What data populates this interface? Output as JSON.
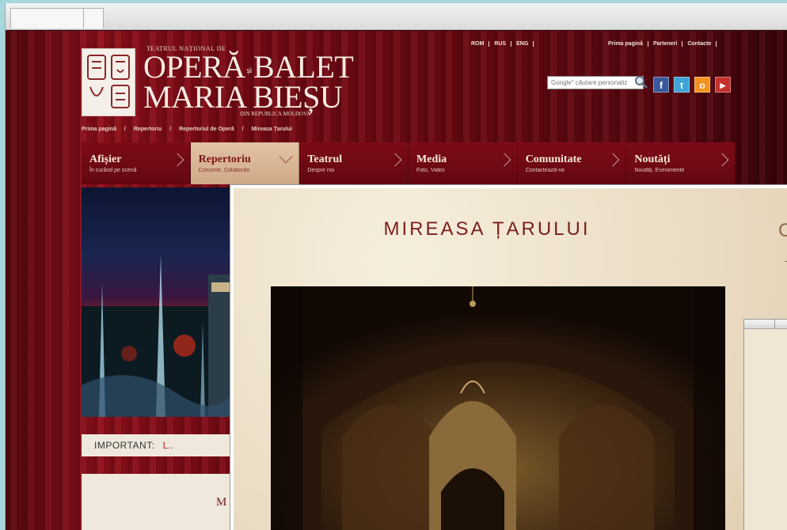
{
  "brand": {
    "top_line": "TEATRUL NAȚIONAL DE",
    "line1_a": "OPERĂ",
    "line1_si": "și",
    "line1_b": "BALET",
    "line2": "MARIA BIEȘU",
    "subline": "DIN REPUBLICA MOLDOVA"
  },
  "languages": [
    "ROM",
    "RUS",
    "ENG"
  ],
  "top_links": [
    "Prima pagină",
    "Parteneri",
    "Contacte"
  ],
  "search": {
    "placeholder": "Google\" căutare personaliz"
  },
  "social": [
    {
      "icon": "facebook-icon",
      "glyph": "f",
      "color": "#3b5998"
    },
    {
      "icon": "twitter-icon",
      "glyph": "t",
      "color": "#3fa4d8"
    },
    {
      "icon": "odnoklassniki-icon",
      "glyph": "o",
      "color": "#f39220"
    },
    {
      "icon": "youtube-icon",
      "glyph": "▶",
      "color": "#c4302b"
    }
  ],
  "breadcrumbs": [
    "Prima pagină",
    "/",
    "Repertoriu",
    "/",
    "Repertoriul de Operă",
    "/",
    "Mireasa Țarului"
  ],
  "nav": [
    {
      "title": "Afișier",
      "subtitle": "În curând pe scenă"
    },
    {
      "title": "Repertoriu",
      "subtitle": "Concerte, Colaborări",
      "active": true
    },
    {
      "title": "Teatrul",
      "subtitle": "Despre noi"
    },
    {
      "title": "Media",
      "subtitle": "Foto, Video"
    },
    {
      "title": "Comunitate",
      "subtitle": "Contactează-ne"
    },
    {
      "title": "Noutăți",
      "subtitle": "Noutăți, Evenimente"
    }
  ],
  "important": {
    "label": "IMPORTANT:",
    "link": "L.."
  },
  "lower_panel": {
    "title_fragment": "M"
  },
  "overlay": {
    "title": "MIREASA ȚARULUI",
    "right_fragment": "C"
  },
  "colors": {
    "accent": "#7a1f1d",
    "nav_active": "#d8b796",
    "bg_red": "#7a0a16"
  }
}
